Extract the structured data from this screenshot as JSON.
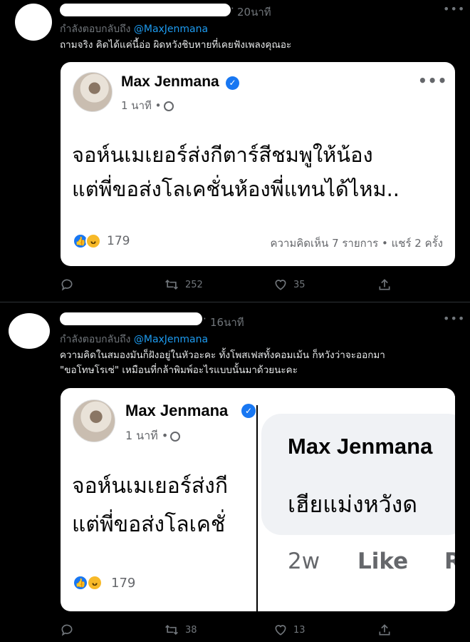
{
  "tweets": [
    {
      "time": "20นาที",
      "reply_prefix": "กำลังตอบกลับถึง",
      "reply_handle": "@MaxJenmana",
      "text_lines": [
        "ถามจริง คิดได้แค่นี้อ่อ ผิดหวังชิบหายที่เคยฟังเพลงคุณอะ"
      ],
      "card": {
        "author": "Max Jenmana",
        "meta": "1 นาที •",
        "post_lines": [
          "จอห์นเมเยอร์ส่งกีตาร์สีชมพูให้น้อง",
          "แต่พี่ขอส่งโลเคชั่นห้องพี่แทนได้ไหม.."
        ],
        "reaction_count": "179",
        "stats": "ความคิดเห็น 7 รายการ • แชร์ 2 ครั้ง"
      },
      "actions": {
        "retweets": "252",
        "likes": "35"
      }
    },
    {
      "time": "16นาที",
      "reply_prefix": "กำลังตอบกลับถึง",
      "reply_handle": "@MaxJenmana",
      "text_lines": [
        "ความคิดในสมองมันก็ฝังอยู่ในหัวอะคะ ทั้งโพสเฟสทั้งคอมเม้น ก็หวังว่าจะออกมา",
        "\"ขอโทษโรเซ่\" เหมือนที่กล้าพิมพ์อะไรแบบนั้นมาด้วยนะคะ"
      ],
      "card": {
        "author": "Max Jenmana",
        "meta": "1 นาที •",
        "post_lines": [
          "จอห์นเมเยอร์ส่งกี",
          "แต่พี่ขอส่งโลเคชั่"
        ],
        "reaction_count": "179",
        "comment": {
          "author": "Max Jenmana",
          "text": "เฮียแม่งหวังด",
          "age": "2w",
          "like_label": "Like",
          "reply_label": "R"
        }
      },
      "actions": {
        "retweets": "38",
        "likes": "13"
      }
    }
  ],
  "icons": [
    "reply-icon",
    "retweet-icon",
    "like-icon",
    "share-icon",
    "more-icon",
    "verified-icon",
    "globe-icon"
  ]
}
